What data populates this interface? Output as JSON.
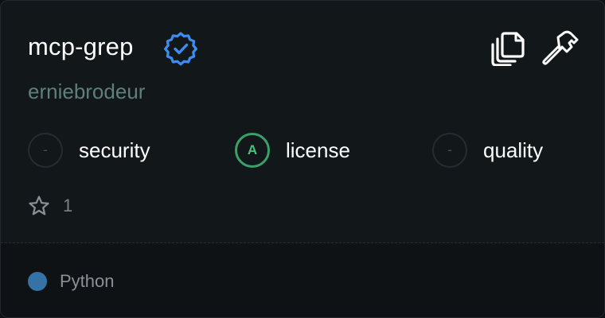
{
  "server": {
    "name": "mcp-grep",
    "author": "erniebrodeur",
    "verified": true
  },
  "actions": {
    "copy_icon": "copy-icon",
    "tools_icon": "hammer-icon"
  },
  "metrics": {
    "security": {
      "grade": "-",
      "label": "security"
    },
    "license": {
      "grade": "A",
      "label": "license"
    },
    "quality": {
      "grade": "-",
      "label": "quality"
    }
  },
  "stars": {
    "count": "1"
  },
  "language": {
    "name": "Python",
    "color": "#3572A5"
  },
  "colors": {
    "verified": "#3b8ef0",
    "grade_a": "#3aa06a",
    "author": "#5f7f7a"
  }
}
